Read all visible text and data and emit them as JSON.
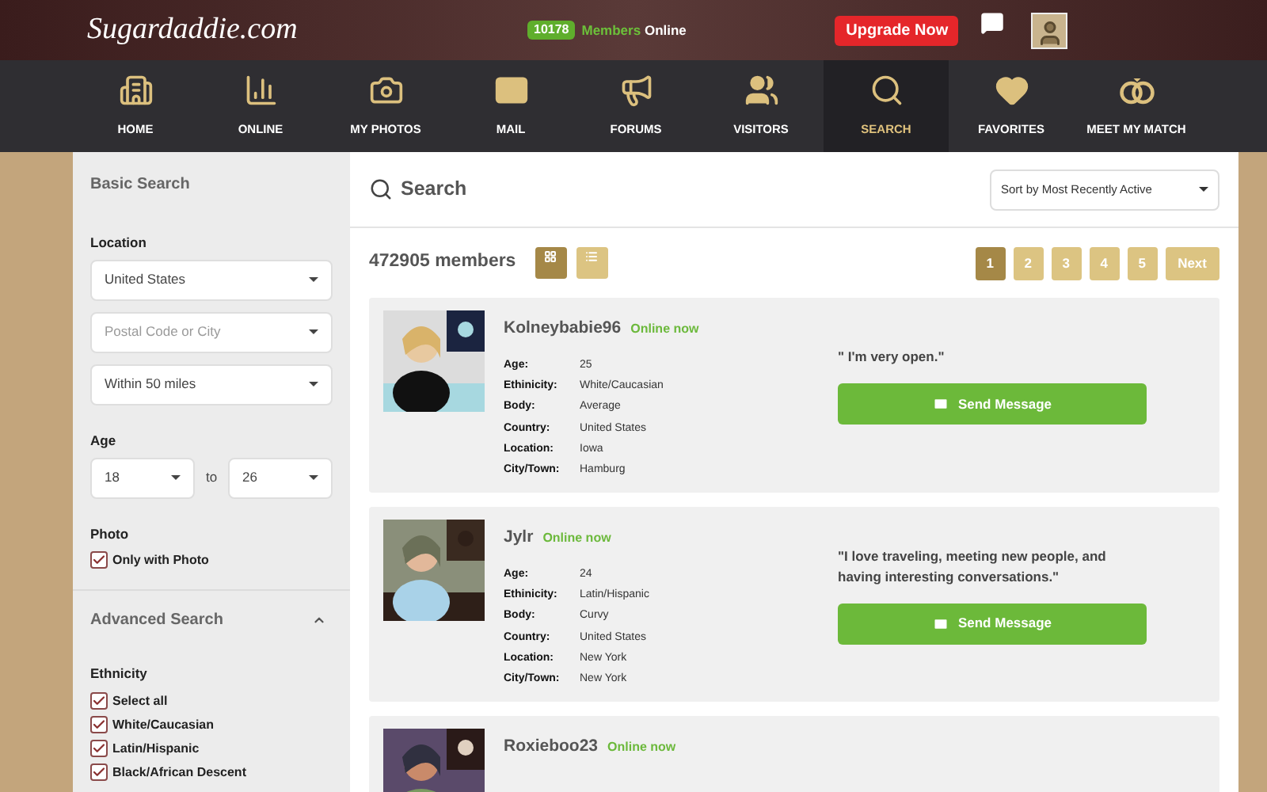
{
  "header": {
    "logo": "Sugardaddie.com",
    "online_count": "10178",
    "online_label_1": "Members",
    "online_label_2": "Online",
    "upgrade": "Upgrade Now"
  },
  "nav": [
    {
      "label": "HOME",
      "kind": "building",
      "selected": false
    },
    {
      "label": "ONLINE",
      "kind": "bars",
      "selected": false
    },
    {
      "label": "MY PHOTOS",
      "kind": "camera",
      "selected": false
    },
    {
      "label": "MAIL",
      "kind": "mail",
      "selected": false
    },
    {
      "label": "FORUMS",
      "kind": "megaphone",
      "selected": false
    },
    {
      "label": "VISITORS",
      "kind": "users",
      "selected": false
    },
    {
      "label": "SEARCH",
      "kind": "search",
      "selected": true
    },
    {
      "label": "FAVORITES",
      "kind": "heart",
      "selected": false
    },
    {
      "label": "MEET MY MATCH",
      "kind": "rings",
      "selected": false
    }
  ],
  "sidebar": {
    "title": "Basic Search",
    "location_label": "Location",
    "country": "United States",
    "postal_placeholder": "Postal Code or City",
    "distance": "Within 50 miles",
    "age_label": "Age",
    "age_from": "18",
    "age_to_label": "to",
    "age_to": "26",
    "photo_label": "Photo",
    "photo_option": {
      "label": "Only with Photo",
      "checked": true
    },
    "advanced_title": "Advanced Search",
    "advanced_expanded": true,
    "ethnicity_label": "Ethnicity",
    "ethnicity": [
      {
        "label": "Select all",
        "checked": true
      },
      {
        "label": "White/Caucasian",
        "checked": true
      },
      {
        "label": "Latin/Hispanic",
        "checked": true
      },
      {
        "label": "Black/African Descent",
        "checked": true
      }
    ]
  },
  "main": {
    "title": "Search",
    "sort": "Sort by Most Recently Active",
    "count": "472905 members",
    "views": [
      {
        "kind": "grid",
        "selected": true
      },
      {
        "kind": "list",
        "selected": false
      }
    ],
    "pages": [
      {
        "label": "1",
        "selected": true
      },
      {
        "label": "2",
        "selected": false
      },
      {
        "label": "3",
        "selected": false
      },
      {
        "label": "4",
        "selected": false
      },
      {
        "label": "5",
        "selected": false
      },
      {
        "label": "Next",
        "selected": false
      }
    ],
    "profiles": [
      {
        "name": "Kolneybabie96",
        "status": "Online now",
        "details": [
          {
            "label": "Age:",
            "value": "25"
          },
          {
            "label": "Ethinicity:",
            "value": "White/Caucasian"
          },
          {
            "label": "Body:",
            "value": "Average"
          },
          {
            "label": "Country:",
            "value": "United States"
          },
          {
            "label": "Location:",
            "value": "Iowa"
          },
          {
            "label": "City/Town:",
            "value": "Hamburg"
          }
        ],
        "quote": "\" I'm very open.\"",
        "button": "Send Message"
      },
      {
        "name": "Jylr",
        "status": "Online now",
        "details": [
          {
            "label": "Age:",
            "value": "24"
          },
          {
            "label": "Ethinicity:",
            "value": "Latin/Hispanic"
          },
          {
            "label": "Body:",
            "value": "Curvy"
          },
          {
            "label": "Country:",
            "value": "United States"
          },
          {
            "label": "Location:",
            "value": "New York"
          },
          {
            "label": "City/Town:",
            "value": "New York"
          }
        ],
        "quote": "\"I love traveling, meeting new people, and having interesting conversations.\"",
        "button": "Send Message"
      },
      {
        "name": "Roxieboo23",
        "status": "Online now"
      }
    ]
  }
}
